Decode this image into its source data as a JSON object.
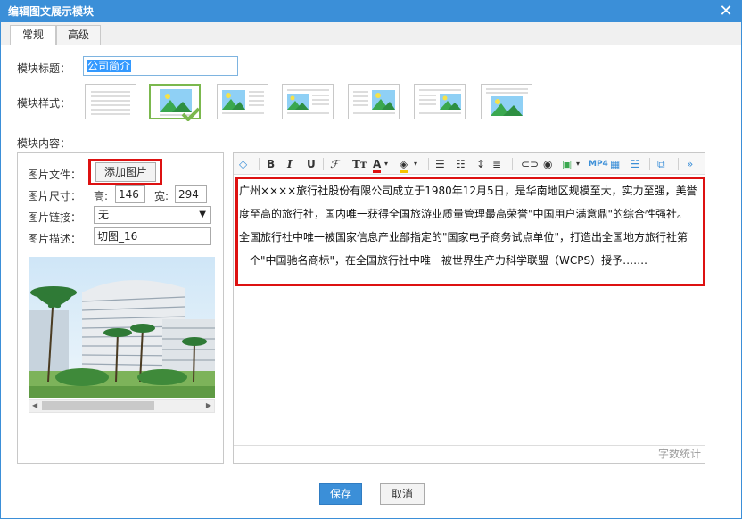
{
  "dialog": {
    "title": "编辑图文展示模块",
    "close_icon": "close-icon"
  },
  "tabs": [
    "常规",
    "高级"
  ],
  "form": {
    "title_label": "模块标题：",
    "title_value": "公司简介",
    "style_label": "模块样式：",
    "content_label": "模块内容："
  },
  "image": {
    "file_label": "图片文件：",
    "add_button": "添加图片",
    "size_label": "图片尺寸：",
    "height_label": "高:",
    "height_value": "146",
    "width_label": "宽:",
    "width_value": "294",
    "link_label": "图片链接：",
    "link_value": "无",
    "desc_label": "图片描述：",
    "desc_value": "切图_16"
  },
  "editor": {
    "toolbar": {
      "bold": "B",
      "italic": "I",
      "underline": "U",
      "mp4": "MP4"
    },
    "content": [
      "广州××××旅行社股份有限公司成立于1980年12月5日，是华南地区规模至大，实力至强，美誉",
      "度至高的旅行社，国内唯一获得全国旅游业质量管理最高荣誉\"中国用户满意鼎\"的综合性强社。",
      "全国旅行社中唯一被国家信息产业部指定的\"国家电子商务试点单位\"，打造出全国地方旅行社第",
      "一个\"中国驰名商标\"，在全国旅行社中唯一被世界生产力科学联盟（WCPS）授予……."
    ],
    "word_count": "字数统计"
  },
  "buttons": {
    "save": "保存",
    "cancel": "取消"
  },
  "colors": {
    "accent": "#3b8fd8",
    "highlight": "#dd1111",
    "selected": "#7bb84e"
  }
}
